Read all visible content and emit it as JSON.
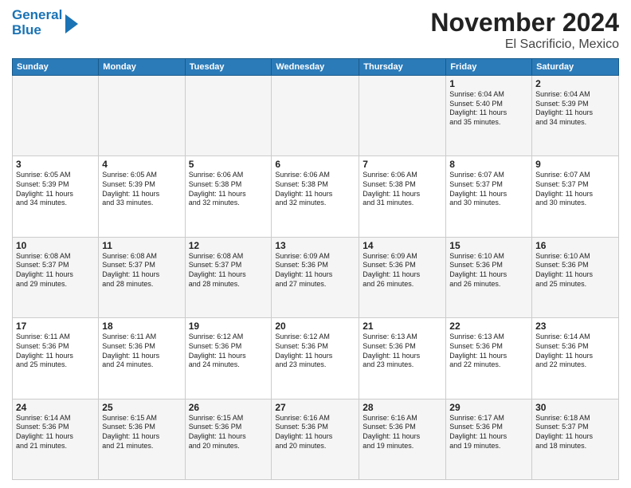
{
  "header": {
    "logo_line1": "General",
    "logo_line2": "Blue",
    "title": "November 2024",
    "subtitle": "El Sacrificio, Mexico"
  },
  "days_of_week": [
    "Sunday",
    "Monday",
    "Tuesday",
    "Wednesday",
    "Thursday",
    "Friday",
    "Saturday"
  ],
  "weeks": [
    [
      {
        "day": "",
        "info": ""
      },
      {
        "day": "",
        "info": ""
      },
      {
        "day": "",
        "info": ""
      },
      {
        "day": "",
        "info": ""
      },
      {
        "day": "",
        "info": ""
      },
      {
        "day": "1",
        "info": "Sunrise: 6:04 AM\nSunset: 5:40 PM\nDaylight: 11 hours\nand 35 minutes."
      },
      {
        "day": "2",
        "info": "Sunrise: 6:04 AM\nSunset: 5:39 PM\nDaylight: 11 hours\nand 34 minutes."
      }
    ],
    [
      {
        "day": "3",
        "info": "Sunrise: 6:05 AM\nSunset: 5:39 PM\nDaylight: 11 hours\nand 34 minutes."
      },
      {
        "day": "4",
        "info": "Sunrise: 6:05 AM\nSunset: 5:39 PM\nDaylight: 11 hours\nand 33 minutes."
      },
      {
        "day": "5",
        "info": "Sunrise: 6:06 AM\nSunset: 5:38 PM\nDaylight: 11 hours\nand 32 minutes."
      },
      {
        "day": "6",
        "info": "Sunrise: 6:06 AM\nSunset: 5:38 PM\nDaylight: 11 hours\nand 32 minutes."
      },
      {
        "day": "7",
        "info": "Sunrise: 6:06 AM\nSunset: 5:38 PM\nDaylight: 11 hours\nand 31 minutes."
      },
      {
        "day": "8",
        "info": "Sunrise: 6:07 AM\nSunset: 5:37 PM\nDaylight: 11 hours\nand 30 minutes."
      },
      {
        "day": "9",
        "info": "Sunrise: 6:07 AM\nSunset: 5:37 PM\nDaylight: 11 hours\nand 30 minutes."
      }
    ],
    [
      {
        "day": "10",
        "info": "Sunrise: 6:08 AM\nSunset: 5:37 PM\nDaylight: 11 hours\nand 29 minutes."
      },
      {
        "day": "11",
        "info": "Sunrise: 6:08 AM\nSunset: 5:37 PM\nDaylight: 11 hours\nand 28 minutes."
      },
      {
        "day": "12",
        "info": "Sunrise: 6:08 AM\nSunset: 5:37 PM\nDaylight: 11 hours\nand 28 minutes."
      },
      {
        "day": "13",
        "info": "Sunrise: 6:09 AM\nSunset: 5:36 PM\nDaylight: 11 hours\nand 27 minutes."
      },
      {
        "day": "14",
        "info": "Sunrise: 6:09 AM\nSunset: 5:36 PM\nDaylight: 11 hours\nand 26 minutes."
      },
      {
        "day": "15",
        "info": "Sunrise: 6:10 AM\nSunset: 5:36 PM\nDaylight: 11 hours\nand 26 minutes."
      },
      {
        "day": "16",
        "info": "Sunrise: 6:10 AM\nSunset: 5:36 PM\nDaylight: 11 hours\nand 25 minutes."
      }
    ],
    [
      {
        "day": "17",
        "info": "Sunrise: 6:11 AM\nSunset: 5:36 PM\nDaylight: 11 hours\nand 25 minutes."
      },
      {
        "day": "18",
        "info": "Sunrise: 6:11 AM\nSunset: 5:36 PM\nDaylight: 11 hours\nand 24 minutes."
      },
      {
        "day": "19",
        "info": "Sunrise: 6:12 AM\nSunset: 5:36 PM\nDaylight: 11 hours\nand 24 minutes."
      },
      {
        "day": "20",
        "info": "Sunrise: 6:12 AM\nSunset: 5:36 PM\nDaylight: 11 hours\nand 23 minutes."
      },
      {
        "day": "21",
        "info": "Sunrise: 6:13 AM\nSunset: 5:36 PM\nDaylight: 11 hours\nand 23 minutes."
      },
      {
        "day": "22",
        "info": "Sunrise: 6:13 AM\nSunset: 5:36 PM\nDaylight: 11 hours\nand 22 minutes."
      },
      {
        "day": "23",
        "info": "Sunrise: 6:14 AM\nSunset: 5:36 PM\nDaylight: 11 hours\nand 22 minutes."
      }
    ],
    [
      {
        "day": "24",
        "info": "Sunrise: 6:14 AM\nSunset: 5:36 PM\nDaylight: 11 hours\nand 21 minutes."
      },
      {
        "day": "25",
        "info": "Sunrise: 6:15 AM\nSunset: 5:36 PM\nDaylight: 11 hours\nand 21 minutes."
      },
      {
        "day": "26",
        "info": "Sunrise: 6:15 AM\nSunset: 5:36 PM\nDaylight: 11 hours\nand 20 minutes."
      },
      {
        "day": "27",
        "info": "Sunrise: 6:16 AM\nSunset: 5:36 PM\nDaylight: 11 hours\nand 20 minutes."
      },
      {
        "day": "28",
        "info": "Sunrise: 6:16 AM\nSunset: 5:36 PM\nDaylight: 11 hours\nand 19 minutes."
      },
      {
        "day": "29",
        "info": "Sunrise: 6:17 AM\nSunset: 5:36 PM\nDaylight: 11 hours\nand 19 minutes."
      },
      {
        "day": "30",
        "info": "Sunrise: 6:18 AM\nSunset: 5:37 PM\nDaylight: 11 hours\nand 18 minutes."
      }
    ]
  ]
}
